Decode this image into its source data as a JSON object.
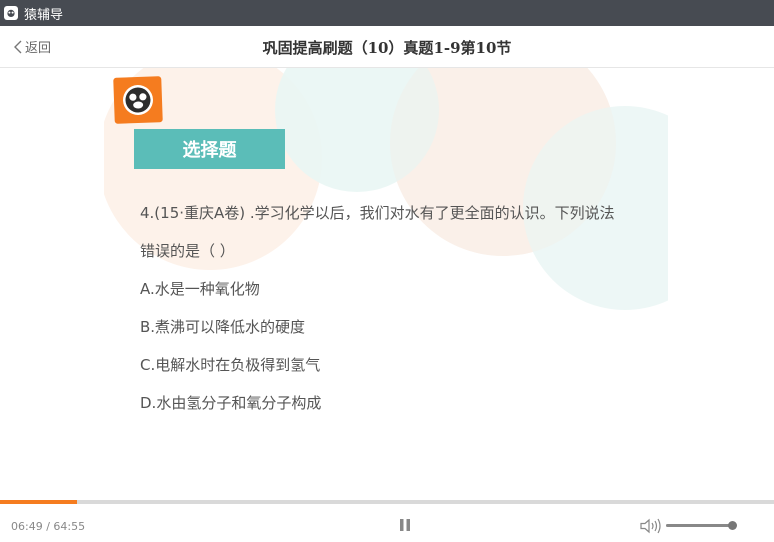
{
  "window": {
    "app_title": "猿辅导",
    "app_icon": "monkey-logo-icon"
  },
  "header": {
    "back_label": "返回",
    "title": "巩固提高刷题（10）真题1-9第10节"
  },
  "slide": {
    "section_tag": "选择题",
    "question_lines": [
      "4.(15·重庆A卷) .学习化学以后，我们对水有了更全面的认识。下列说法",
      "错误的是（  ）"
    ],
    "options": [
      "A.水是一种氧化物",
      "B.煮沸可以降低水的硬度",
      "C.电解水时在负极得到氢气",
      "D.水由氢分子和氧分子构成"
    ]
  },
  "player": {
    "time": "06:49 / 64:55",
    "progress": 0.099,
    "volume": 1.0,
    "pause_icon": "pause-icon",
    "volume_icon": "speaker-icon"
  },
  "colors": {
    "titlebar": "#474b52",
    "accent_orange": "#f57c1f",
    "tag_teal": "#5bbdb8"
  }
}
